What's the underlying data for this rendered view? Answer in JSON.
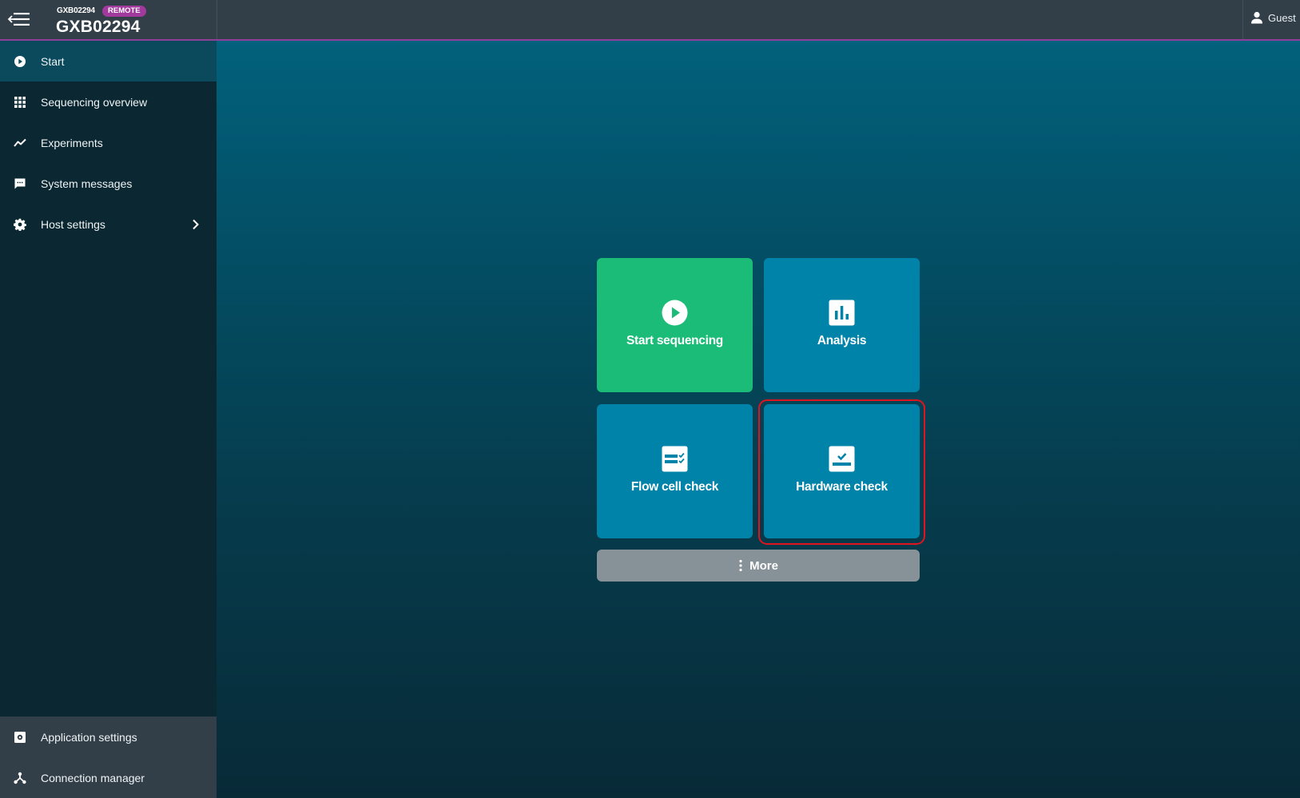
{
  "header": {
    "device_small": "GXB02294",
    "badge": "REMOTE",
    "device_title": "GXB02294",
    "user": "Guest",
    "accent_color": "#8f3f97"
  },
  "sidebar": {
    "items": [
      {
        "label": "Start",
        "icon": "play-circle-icon",
        "active": true
      },
      {
        "label": "Sequencing overview",
        "icon": "grid-icon"
      },
      {
        "label": "Experiments",
        "icon": "trend-line-icon"
      },
      {
        "label": "System messages",
        "icon": "message-icon"
      },
      {
        "label": "Host settings",
        "icon": "gear-icon",
        "has_submenu": true
      }
    ],
    "bottom_items": [
      {
        "label": "Application settings",
        "icon": "settings-box-icon"
      },
      {
        "label": "Connection manager",
        "icon": "network-icon"
      }
    ]
  },
  "main": {
    "tiles": [
      {
        "label": "Start sequencing",
        "icon": "play-circle-icon",
        "color": "#1bbc77"
      },
      {
        "label": "Analysis",
        "icon": "bar-chart-icon",
        "color": "#0083a9"
      },
      {
        "label": "Flow cell check",
        "icon": "checklist-icon",
        "color": "#0083a9"
      },
      {
        "label": "Hardware check",
        "icon": "hardware-check-icon",
        "color": "#0083a9",
        "highlighted": true
      }
    ],
    "more_label": "More",
    "highlight_color": "#e0141e"
  }
}
